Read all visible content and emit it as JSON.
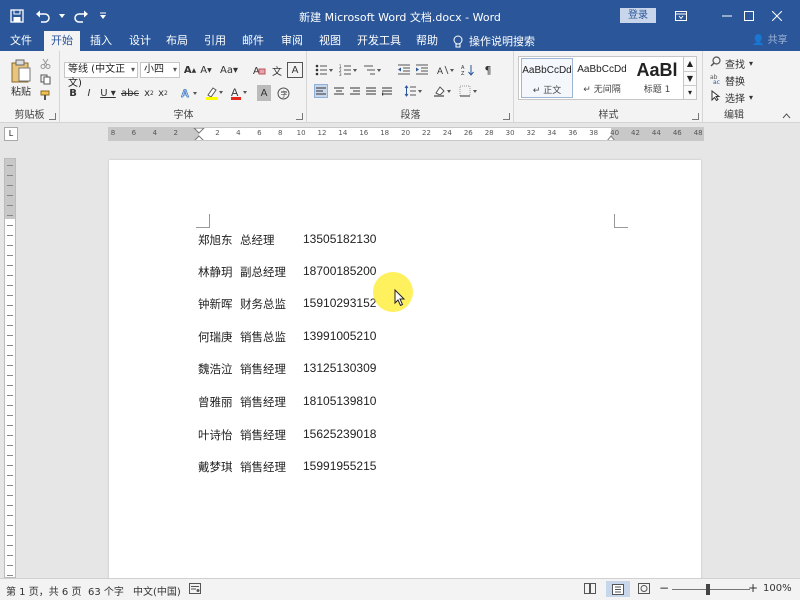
{
  "window": {
    "title": "新建 Microsoft Word 文档.docx  -  Word",
    "login_label": "登录"
  },
  "tabs": [
    "文件",
    "开始",
    "插入",
    "设计",
    "布局",
    "引用",
    "邮件",
    "审阅",
    "视图",
    "开发工具",
    "帮助"
  ],
  "active_tab": "开始",
  "tell_me": "操作说明搜索",
  "share": "共享",
  "ribbon": {
    "clipboard": {
      "paste": "粘贴",
      "label": "剪贴板"
    },
    "font": {
      "name": "等线 (中文正文)",
      "size": "小四",
      "label": "字体"
    },
    "paragraph": {
      "label": "段落"
    },
    "styles": {
      "label": "样式",
      "items": [
        {
          "preview": "AaBbCcDd",
          "name": "↵ 正文"
        },
        {
          "preview": "AaBbCcDd",
          "name": "↵ 无间隔"
        },
        {
          "preview": "AaBl",
          "name": "标题 1"
        }
      ]
    },
    "editing": {
      "find": "查找",
      "replace": "替换",
      "select": "选择",
      "label": "编辑"
    }
  },
  "ruler": {
    "labels": [
      "8",
      "6",
      "4",
      "2",
      "",
      "2",
      "4",
      "6",
      "8",
      "10",
      "12",
      "14",
      "16",
      "18",
      "20",
      "22",
      "24",
      "26",
      "28",
      "30",
      "32",
      "34",
      "36",
      "38",
      "40",
      "42",
      "44",
      "46",
      "48"
    ]
  },
  "document": {
    "rows": [
      {
        "name": "郑旭东",
        "title": "总经理",
        "phone": "13505182130"
      },
      {
        "name": "林静玥",
        "title": "副总经理",
        "phone": "18700185200"
      },
      {
        "name": "钟新晖",
        "title": "财务总监",
        "phone": "15910293152"
      },
      {
        "name": "何瑞庚",
        "title": "销售总监",
        "phone": "13991005210"
      },
      {
        "name": "魏浩泣",
        "title": "销售经理",
        "phone": "13125130309"
      },
      {
        "name": "曾雅丽",
        "title": "销售经理",
        "phone": "18105139810"
      },
      {
        "name": "叶诗怡",
        "title": "销售经理",
        "phone": "15625239018"
      },
      {
        "name": "戴梦琪",
        "title": "销售经理",
        "phone": "15991955215"
      }
    ]
  },
  "status": {
    "page": "第 1 页，共 6 页",
    "words": "63 个字",
    "language": "中文(中国)",
    "zoom": "100%"
  },
  "colors": {
    "brand": "#2b579a",
    "highlight": "#ffeb28"
  }
}
